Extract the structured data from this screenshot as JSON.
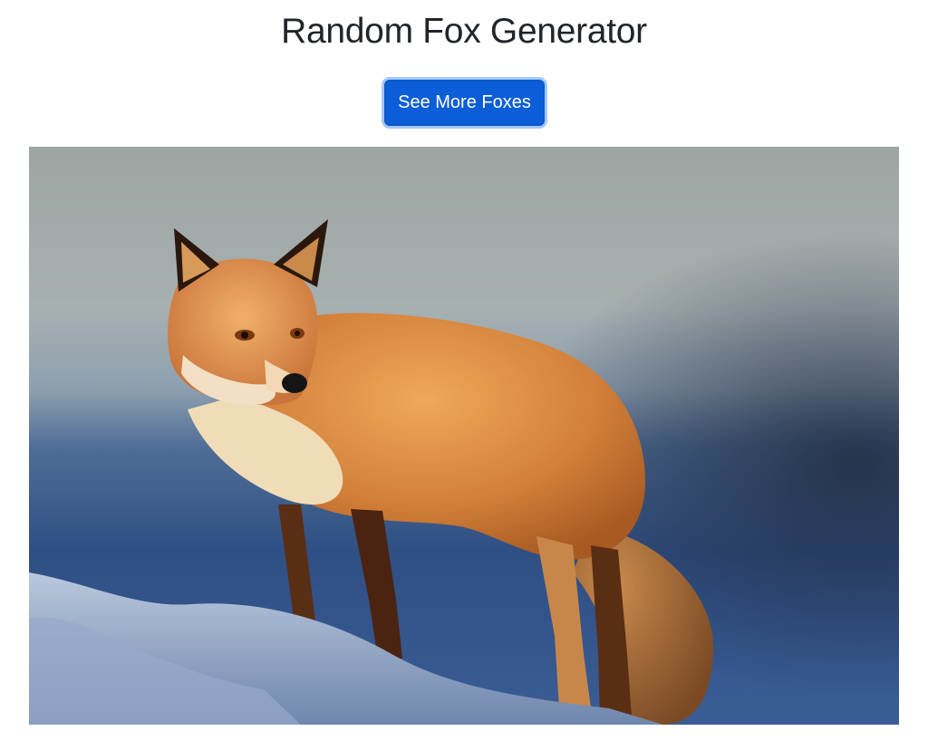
{
  "header": {
    "title": "Random Fox Generator"
  },
  "actions": {
    "see_more_label": "See More Foxes"
  },
  "photo": {
    "subject": "fox-photo",
    "colors": {
      "sky_top": "#a2aaa8",
      "sky_mid": "#7f95a8",
      "water_blue": "#2f4f7f",
      "fur_orange": "#d98a3e",
      "fur_light": "#f1d4a8",
      "fur_dark": "#6b3a17",
      "snow": "#c9d6e6"
    }
  },
  "colors": {
    "primary": "#0b5ed7",
    "focus_ring": "#8bb9fe",
    "text": "#212529"
  }
}
